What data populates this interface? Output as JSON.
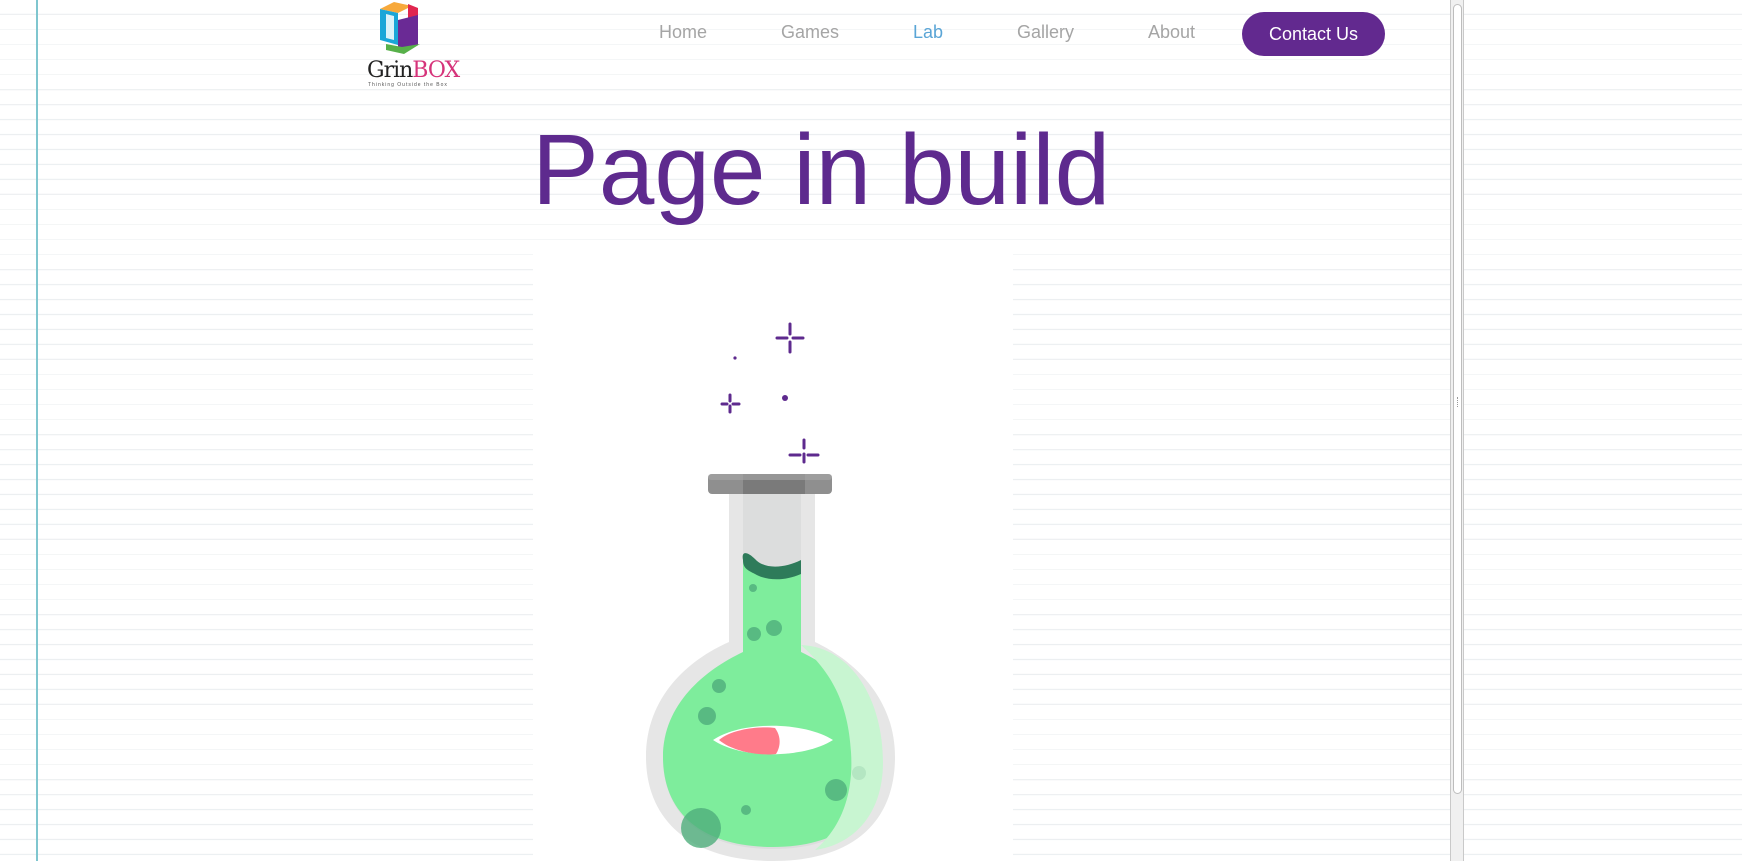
{
  "brand": {
    "logo_text_main": "Grin",
    "logo_text_accent": "BOX",
    "logo_tagline": "Thinking Outside the Box",
    "colors": {
      "cube_orange": "#f7a93b",
      "cube_cyan": "#1aa6d8",
      "cube_red": "#e0264f",
      "cube_purple": "#6a2a95",
      "cube_green": "#57b04a"
    }
  },
  "nav": {
    "items": [
      {
        "label": "Home",
        "active": false
      },
      {
        "label": "Games",
        "active": false
      },
      {
        "label": "Lab",
        "active": true
      },
      {
        "label": "Gallery",
        "active": false
      },
      {
        "label": "About",
        "active": false
      }
    ],
    "contact_label": "Contact Us"
  },
  "main": {
    "title": "Page in build",
    "illustration": "potion-flask-illustration"
  },
  "colors": {
    "accent_purple": "#62298f",
    "title_purple": "#5e2a8e",
    "nav_active": "#5aa5d6",
    "nav_inactive": "#a5a5a5",
    "liquid_green": "#7eed9c",
    "liquid_dark": "#2e7b5a",
    "eye_pink": "#ff7b8a"
  }
}
